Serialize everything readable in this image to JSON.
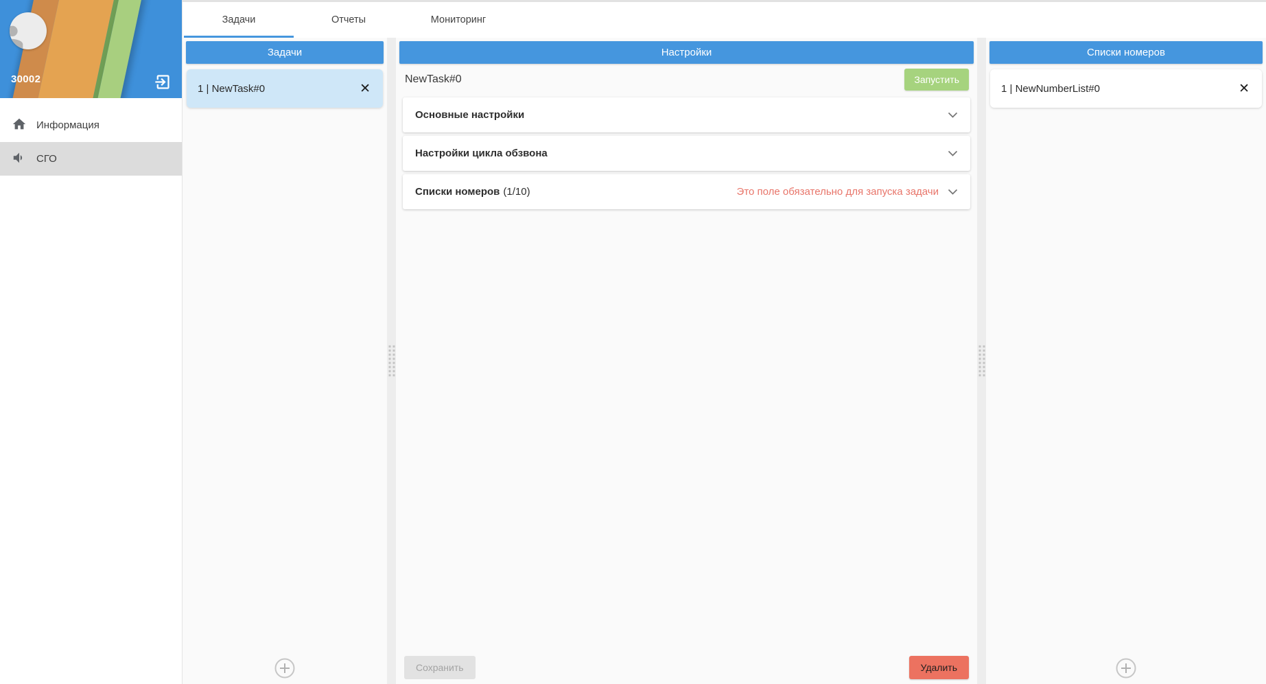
{
  "sidebar": {
    "user_id": "30002",
    "menu": [
      {
        "label": "Информация",
        "icon": "home-icon",
        "selected": false
      },
      {
        "label": "СГО",
        "icon": "volume-icon",
        "selected": true
      }
    ]
  },
  "tabs": [
    {
      "label": "Задачи",
      "active": true
    },
    {
      "label": "Отчеты",
      "active": false
    },
    {
      "label": "Мониторинг",
      "active": false
    }
  ],
  "tasks_panel": {
    "title": "Задачи",
    "items": [
      {
        "label": "1 | NewTask#0",
        "selected": true
      }
    ],
    "close_icon": "✕"
  },
  "settings_panel": {
    "title": "Настройки",
    "task_name": "NewTask#0",
    "run_button": "Запустить",
    "sections": [
      {
        "title": "Основные настройки",
        "suffix": "",
        "warning": ""
      },
      {
        "title": "Настройки цикла обзвона",
        "suffix": "",
        "warning": ""
      },
      {
        "title": "Списки номеров",
        "suffix": "(1/10)",
        "warning": "Это поле обязательно для запуска задачи"
      }
    ],
    "save_button": "Сохранить",
    "delete_button": "Удалить"
  },
  "numbers_panel": {
    "title": "Списки номеров",
    "items": [
      {
        "label": "1 | NewNumberList#0",
        "selected": false
      }
    ],
    "close_icon": "✕"
  },
  "colors": {
    "accent_blue": "#4596de",
    "selected_item_blue": "#cfe7f8",
    "run_green": "#a6d37e",
    "delete_red": "#ec7260",
    "warning_red": "#e8756a",
    "banner_orange": "#e4a351",
    "banner_green": "#a8cf7f"
  }
}
